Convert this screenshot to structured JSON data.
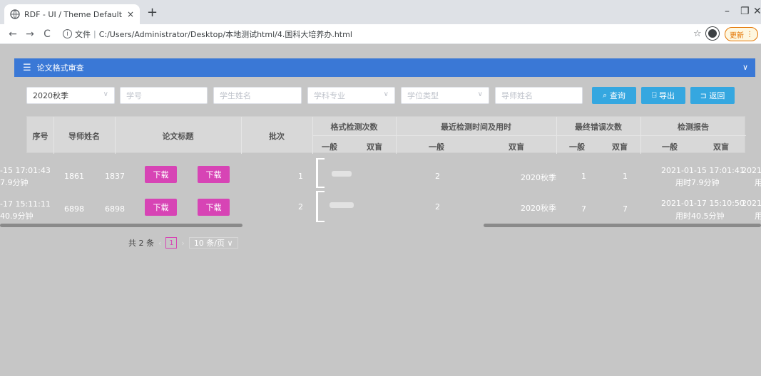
{
  "browser": {
    "tab_title": "RDF - UI / Theme Default",
    "tab_close": "×",
    "new_tab": "+",
    "url_prefix": "文件",
    "url": "C:/Users/Administrator/Desktop/本地测试html/4.国科大培养办.html",
    "update_label": "更新"
  },
  "panel": {
    "title": "论文格式审查"
  },
  "filters": {
    "semester": "2020秋季",
    "student_id": "学号",
    "student_name": "学生姓名",
    "major": "学科专业",
    "degree_type": "学位类型",
    "advisor_name": "导师姓名"
  },
  "buttons": {
    "query": "查询",
    "export": "导出",
    "back": "返回"
  },
  "table": {
    "headers": {
      "index": "序号",
      "advisor": "导师姓名",
      "title": "论文标题",
      "batch": "批次",
      "format_checks": "格式检测次数",
      "recent_check": "最近检测时间及用时",
      "final_errors": "最终错误次数",
      "report": "检测报告",
      "general": "一般",
      "dual": "双盲"
    },
    "rows": [
      {
        "left_time": "-15 17:01:43",
        "left_dur": "7.9分钟",
        "a": "1861",
        "b": "1837",
        "download": "下载",
        "batch": "1",
        "recent_general": "2",
        "recent_dual": "2020秋季",
        "err_general": "1",
        "err_dual": "1",
        "report_time": "2021-01-15 17:01:41",
        "report_dur": "用时7.9分钟",
        "report_time2": "2021-",
        "report_dur2": "用"
      },
      {
        "left_time": "-17 15:11:11",
        "left_dur": "40.9分钟",
        "a": "6898",
        "b": "6898",
        "download": "下载",
        "batch": "2",
        "recent_general": "2",
        "recent_dual": "2020秋季",
        "err_general": "7",
        "err_dual": "7",
        "report_time": "2021-01-17 15:10:50",
        "report_dur": "用时40.5分钟",
        "report_time2": "2021-",
        "report_dur2": "用"
      }
    ]
  },
  "pager": {
    "total": "共 2 条",
    "page": "1",
    "page_size": "10 条/页"
  }
}
